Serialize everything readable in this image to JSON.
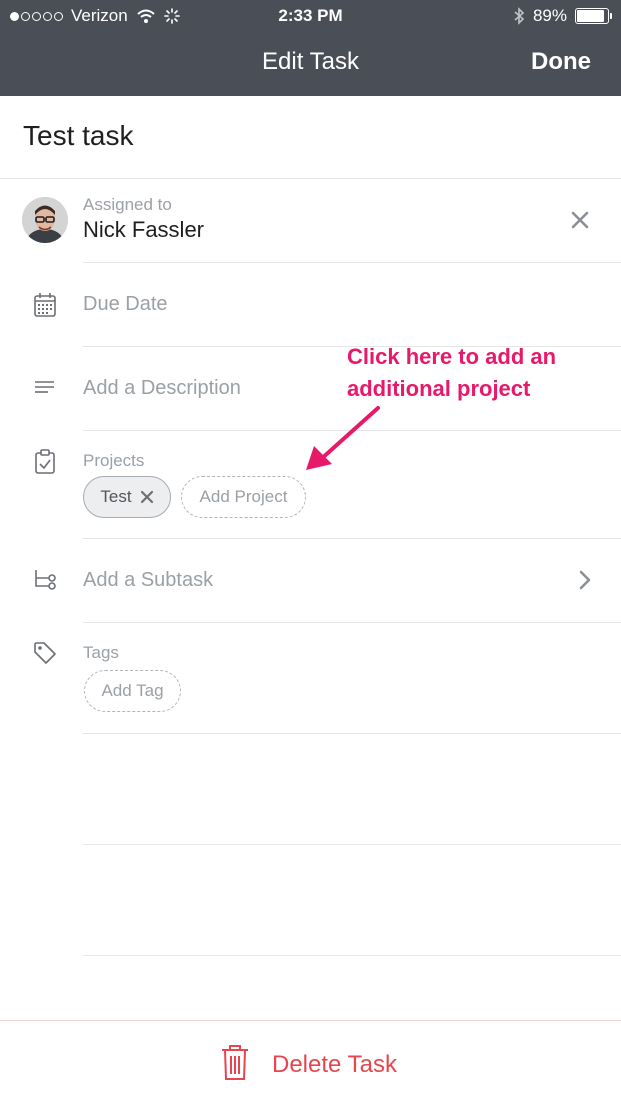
{
  "status_bar": {
    "carrier": "Verizon",
    "time": "2:33 PM",
    "battery": "89%",
    "battery_level": 0.89,
    "signal_bars": 1
  },
  "nav": {
    "title": "Edit Task",
    "done_label": "Done"
  },
  "task": {
    "name": "Test task"
  },
  "assignee": {
    "label": "Assigned to",
    "name": "Nick Fassler"
  },
  "due_date": {
    "placeholder": "Due Date"
  },
  "description": {
    "placeholder": "Add a Description"
  },
  "projects": {
    "label": "Projects",
    "items": [
      {
        "name": "Test"
      }
    ],
    "add_label": "Add Project"
  },
  "subtask": {
    "placeholder": "Add a Subtask"
  },
  "tags": {
    "label": "Tags",
    "add_label": "Add Tag"
  },
  "annotation": {
    "line1": "Click here to add an",
    "line2": "additional project"
  },
  "footer": {
    "delete_label": "Delete Task"
  },
  "colors": {
    "nav_bg": "#4a4f57",
    "annotation": "#e8196a",
    "danger": "#e8464e",
    "muted_text": "#9aa0a6"
  }
}
